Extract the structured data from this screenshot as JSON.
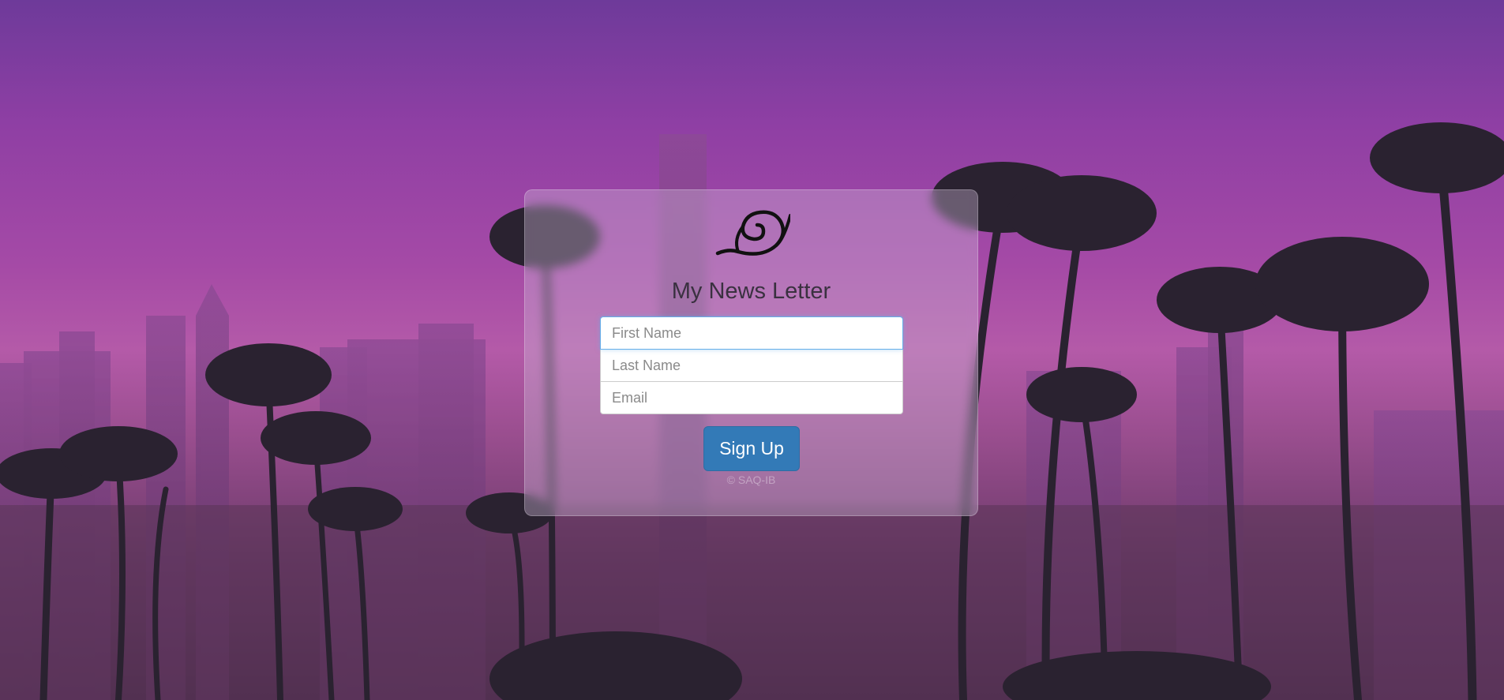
{
  "background": {
    "description_icon": "city-skyline-palms-background",
    "colors": {
      "sky_top": "#6e3a9a",
      "sky_mid": "#b45aa8",
      "palm": "#2a2230"
    }
  },
  "card": {
    "logo_icon": "leaf-village-logo-icon",
    "title": "My News Letter",
    "fields": {
      "first_name_placeholder": "First Name",
      "last_name_placeholder": "Last Name",
      "email_placeholder": "Email"
    },
    "signup_label": "Sign Up",
    "footer": "© SAQ-IB",
    "colors": {
      "button": "#337ab7",
      "focus": "#66afe9"
    }
  }
}
